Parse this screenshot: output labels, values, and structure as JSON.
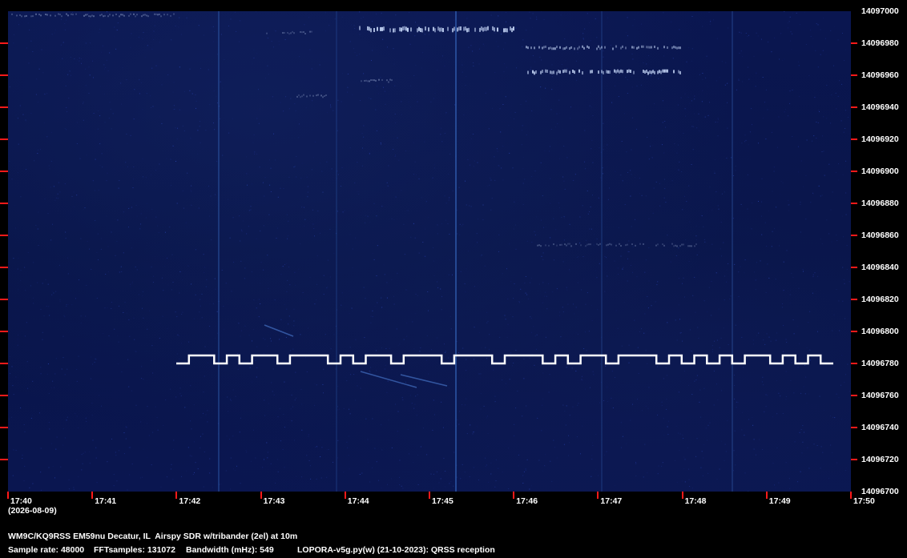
{
  "station": {
    "description": "WM9C/KQ9RSS EM59nu Decatur, IL  Airspy SDR w/tribander (2el) at 10m"
  },
  "parameters": {
    "sample_rate_text": "Sample rate: 48000",
    "fft_samples_text": "FFTsamples: 131072",
    "bandwidth_text": "Bandwidth (mHz): 549",
    "software_text": "LOPORA-v5g.py(w) (21-10-2023): QRSS reception"
  },
  "date_label": "(2026-08-09)",
  "frequency_axis": {
    "labels": [
      "14097000",
      "14096980",
      "14096960",
      "14096940",
      "14096920",
      "14096900",
      "14096880",
      "14096860",
      "14096840",
      "14096820",
      "14096800",
      "14096780",
      "14096760",
      "14096740",
      "14096720",
      "14096700"
    ]
  },
  "time_axis": {
    "labels": [
      "17:40",
      "17:41",
      "17:42",
      "17:43",
      "17:44",
      "17:45",
      "17:46",
      "17:47",
      "17:48",
      "17:49",
      "17:50"
    ]
  },
  "colors": {
    "background": "#000000",
    "waterfall": "#0a1650",
    "tick": "#ff1a1a",
    "signal": "#ffffff",
    "text": "#ffffff"
  },
  "signals": {
    "fsk_trace_low_freq": 14096780,
    "fsk_trace_high_freq": 14096784,
    "fsk_pattern": [
      0,
      1,
      1,
      0,
      1,
      0,
      1,
      1,
      0,
      1,
      1,
      1,
      0,
      1,
      0,
      1,
      1,
      0,
      1,
      1,
      1,
      0,
      1,
      1,
      1,
      0,
      1,
      1,
      1,
      0,
      1,
      0,
      1,
      1,
      0,
      1,
      1,
      1,
      0,
      1,
      0,
      1,
      0,
      1,
      0,
      1,
      1,
      0,
      1,
      0,
      1,
      0
    ]
  }
}
